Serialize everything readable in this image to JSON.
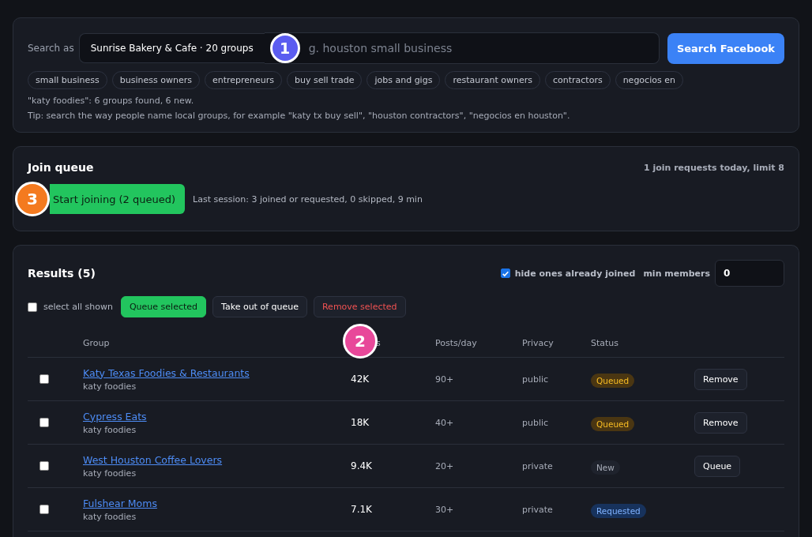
{
  "search": {
    "label": "Search as",
    "account": "Sunrise Bakery & Cafe · 20 groups",
    "placeholder": "g. houston small business",
    "button": "Search Facebook",
    "chips": [
      "small business",
      "business owners",
      "entrepreneurs",
      "buy sell trade",
      "jobs and gigs",
      "restaurant owners",
      "contractors",
      "negocios en"
    ],
    "result_note": "\"katy foodies\": 6 groups found, 6 new.",
    "tip": "Tip: search the way people name local groups, for example \"katy tx buy sell\", \"houston contractors\", \"negocios en houston\"."
  },
  "join_queue": {
    "title": "Join queue",
    "limit_note": "1 join requests today, limit 8",
    "start_button": "Start joining (2 queued)",
    "last_session": "Last session: 3 joined or requested, 0 skipped, 9 min"
  },
  "results": {
    "title": "Results (5)",
    "hide_joined": {
      "label": "hide ones already joined",
      "checked": true
    },
    "min_members": {
      "label": "min members",
      "value": "0"
    },
    "select_all": {
      "label": "select all shown",
      "checked": false
    },
    "actions": [
      {
        "label": "Queue selected",
        "kind": "primary"
      },
      {
        "label": "Take out of queue",
        "kind": "plain"
      },
      {
        "label": "Remove selected",
        "kind": "danger"
      }
    ],
    "columns": [
      "Group",
      "s",
      "Posts/day",
      "Privacy",
      "Status"
    ],
    "rows": [
      {
        "checked": false,
        "name": "Katy Texas Foodies & Restaurants",
        "query": "katy foodies",
        "members": "42K",
        "posts": "90+",
        "privacy": "public",
        "status": "Queued",
        "kind": "queued",
        "action": "Remove"
      },
      {
        "checked": false,
        "name": "Cypress Eats",
        "query": "katy foodies",
        "members": "18K",
        "posts": "40+",
        "privacy": "public",
        "status": "Queued",
        "kind": "queued",
        "action": "Remove"
      },
      {
        "checked": false,
        "name": "West Houston Coffee Lovers",
        "query": "katy foodies",
        "members": "9.4K",
        "posts": "20+",
        "privacy": "private",
        "status": "New",
        "kind": "new",
        "action": "Queue"
      },
      {
        "checked": false,
        "name": "Fulshear Moms",
        "query": "katy foodies",
        "members": "7.1K",
        "posts": "30+",
        "privacy": "private",
        "status": "Requested",
        "kind": "requested"
      }
    ]
  },
  "markers": [
    {
      "label": "1",
      "color": "#5b5cf0"
    },
    {
      "label": "2",
      "color": "#e8489a"
    },
    {
      "label": "3",
      "color": "#f47a1f"
    }
  ]
}
